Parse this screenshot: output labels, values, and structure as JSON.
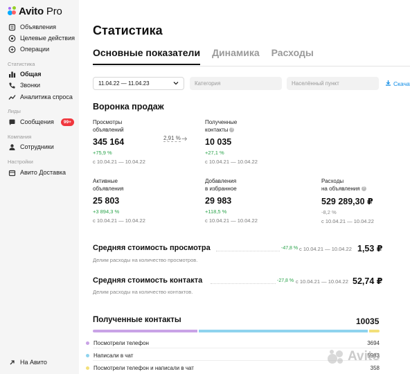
{
  "app": {
    "brand": "Avito",
    "brand_suffix": "Pro"
  },
  "sidebar": {
    "items_top": [
      {
        "label": "Объявления",
        "icon": "document-icon"
      },
      {
        "label": "Целевые действия",
        "icon": "check-circle-icon"
      },
      {
        "label": "Операции",
        "icon": "coins-icon"
      }
    ],
    "section_stats": "Статистика",
    "items_stats": [
      {
        "label": "Общая",
        "icon": "bar-chart-icon",
        "active": true
      },
      {
        "label": "Звонки",
        "icon": "phone-icon"
      },
      {
        "label": "Аналитика спроса",
        "icon": "trend-icon"
      }
    ],
    "section_leads": "Лиды",
    "messages": {
      "label": "Сообщения",
      "badge": "99+"
    },
    "section_company": "Компания",
    "employees": {
      "label": "Сотрудники"
    },
    "section_settings": "Настройки",
    "delivery": {
      "label": "Авито Доставка"
    },
    "back": {
      "label": "На Авито"
    }
  },
  "page": {
    "title": "Статистика",
    "tabs": [
      "Основные показатели",
      "Динамика",
      "Расходы"
    ],
    "active_tab": 0
  },
  "filters": {
    "date_range": "11.04.22 — 11.04.23",
    "category_placeholder": "Категория",
    "city_placeholder": "Населённый пункт",
    "download": "Скачать"
  },
  "funnel": {
    "title": "Воронка продаж",
    "conversion": "2,91 %",
    "metrics": [
      {
        "label1": "Просмотры",
        "label2": "объявлений",
        "value": "345 164",
        "change": "+75,9 %",
        "trend": "up",
        "period": "с 10.04.21 — 10.04.22"
      },
      {
        "label1": "Полученные",
        "label2": "контакты",
        "info": "?",
        "value": "10 035",
        "change": "+27,1 %",
        "trend": "up",
        "period": "с 10.04.21 — 10.04.22"
      },
      {
        "label1": "Активные",
        "label2": "объявления",
        "value": "25 803",
        "change": "+3 894,3 %",
        "trend": "up",
        "period": "с 10.04.21 — 10.04.22"
      },
      {
        "label1": "Добавления",
        "label2": "в избранное",
        "value": "29 983",
        "change": "+118,5 %",
        "trend": "up",
        "period": "с 10.04.21 — 10.04.22"
      },
      {
        "label1": "Расходы",
        "label2": "на объявления",
        "info": "?",
        "value": "529 289,30 ₽",
        "change": "-8,2 %",
        "trend": "down",
        "period": "с 10.04.21 — 10.04.22"
      }
    ]
  },
  "costs": [
    {
      "title": "Средняя стоимость просмотра",
      "change": "-47,8 %",
      "change_color": "#2aa34a",
      "period": "с 10.04.21 — 10.04.22",
      "value": "1,53 ₽",
      "subtitle": "Делим расходы на количество просмотров."
    },
    {
      "title": "Средняя стоимость контакта",
      "change": "-27,8 %",
      "change_color": "#2aa34a",
      "period": "с 10.04.21 — 10.04.22",
      "value": "52,74 ₽",
      "subtitle": "Делим расходы на количество контактов."
    }
  ],
  "contacts": {
    "title": "Полученные контакты",
    "total": "10035",
    "rows": [
      {
        "label": "Посмотрели телефон",
        "value": 3694,
        "value_text": "3694",
        "color": "#c9a3e6"
      },
      {
        "label": "Написали в чат",
        "value": 5983,
        "value_text": "5983",
        "color": "#8fd3ee"
      },
      {
        "label": "Посмотрели телефон и написали в чат",
        "value": 358,
        "value_text": "358",
        "color": "#f3e07a"
      }
    ]
  },
  "watermark": "Avito"
}
